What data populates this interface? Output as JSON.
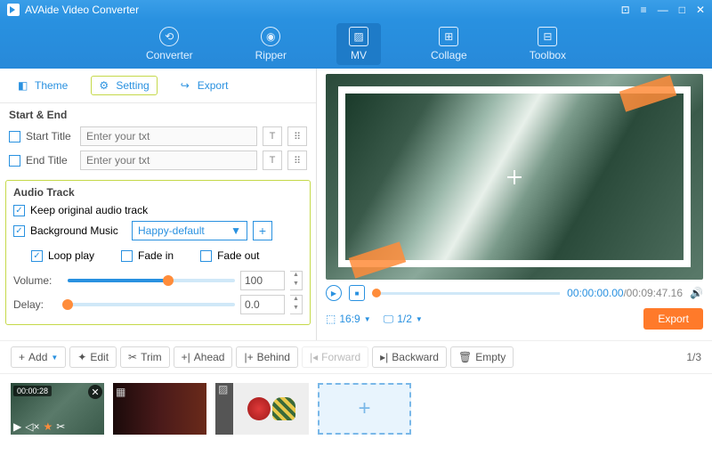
{
  "app": {
    "title": "AVAide Video Converter"
  },
  "toolbar": {
    "items": [
      {
        "label": "Converter"
      },
      {
        "label": "Ripper"
      },
      {
        "label": "MV"
      },
      {
        "label": "Collage"
      },
      {
        "label": "Toolbox"
      }
    ]
  },
  "tabs": {
    "theme": "Theme",
    "setting": "Setting",
    "export": "Export"
  },
  "start_end": {
    "header": "Start & End",
    "start": "Start Title",
    "end": "End Title",
    "placeholder": "Enter your txt"
  },
  "audio": {
    "header": "Audio Track",
    "keep": "Keep original audio track",
    "bg": "Background Music",
    "preset": "Happy-default",
    "loop": "Loop play",
    "fadein": "Fade in",
    "fadeout": "Fade out",
    "volume_l": "Volume:",
    "volume_v": "100",
    "delay_l": "Delay:",
    "delay_v": "0.0"
  },
  "player": {
    "cur": "00:00:00.00",
    "total": "00:09:47.16",
    "ratio": "16:9",
    "page": "1/2"
  },
  "export_btn": "Export",
  "actions": {
    "add": "Add",
    "edit": "Edit",
    "trim": "Trim",
    "ahead": "Ahead",
    "behind": "Behind",
    "forward": "Forward",
    "backward": "Backward",
    "empty": "Empty"
  },
  "pager": "1/3",
  "thumb1_time": "00:00:28"
}
